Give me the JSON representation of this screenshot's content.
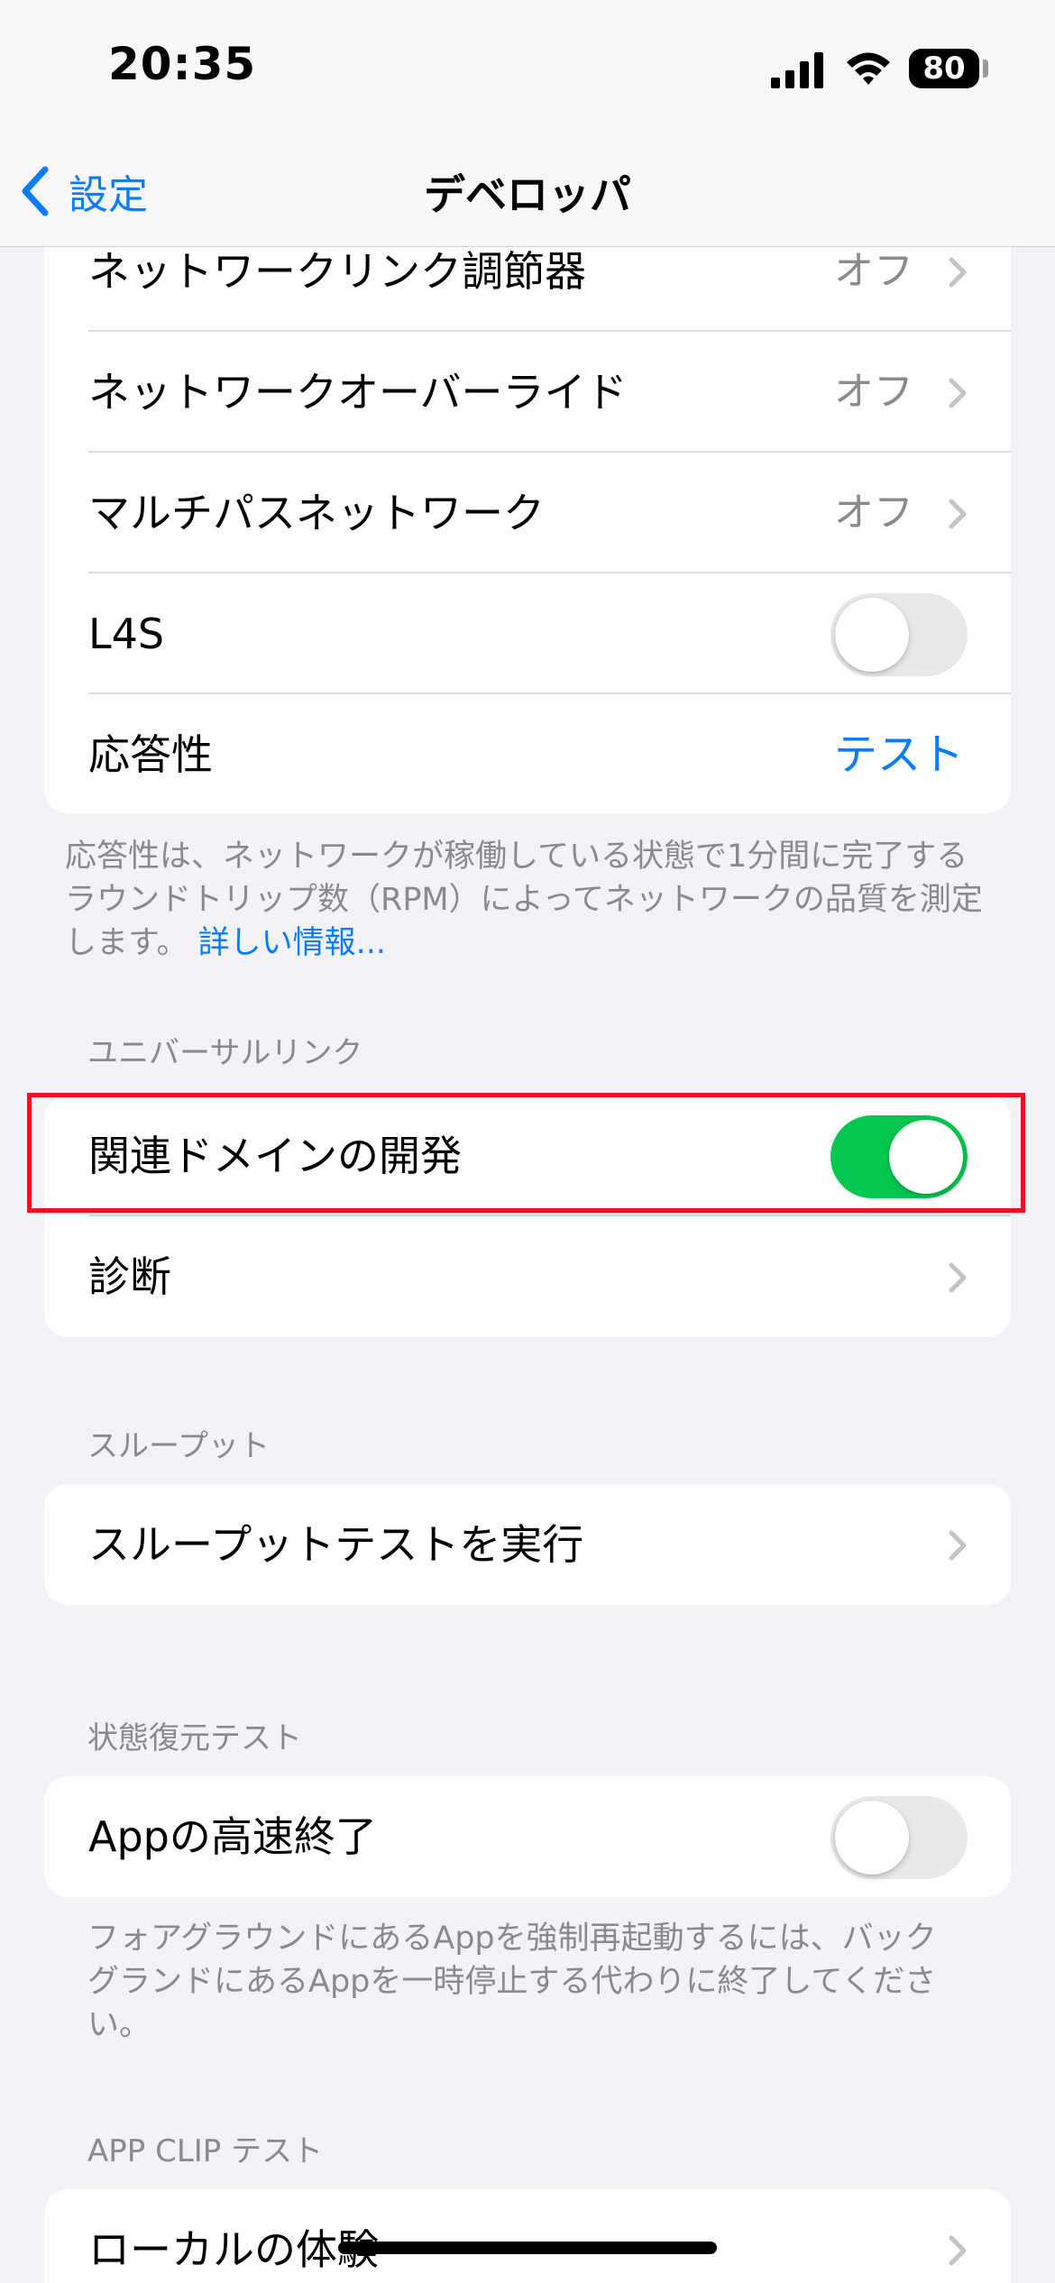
{
  "status_bar": {
    "time": "20:35",
    "battery": "80"
  },
  "nav": {
    "back_label": "設定",
    "title": "デベロッパ"
  },
  "network_group": {
    "rows": [
      {
        "label": "ネットワークリンク調節器",
        "value": "オフ"
      },
      {
        "label": "ネットワークオーバーライド",
        "value": "オフ"
      },
      {
        "label": "マルチパスネットワーク",
        "value": "オフ"
      },
      {
        "label": "L4S",
        "toggle": false
      },
      {
        "label": "応答性",
        "action": "テスト"
      }
    ],
    "footnote": "応答性は、ネットワークが稼働している状態で1分間に完了するラウンドトリップ数（RPM）によってネットワークの品質を測定します。",
    "footnote_link": "詳しい情報..."
  },
  "universal_links": {
    "header": "ユニバーサルリンク",
    "rows": [
      {
        "label": "関連ドメインの開発",
        "toggle": true
      },
      {
        "label": "診断"
      }
    ]
  },
  "throughput": {
    "header": "スループット",
    "rows": [
      {
        "label": "スループットテストを実行"
      }
    ]
  },
  "state_restoration": {
    "header": "状態復元テスト",
    "rows": [
      {
        "label": "Appの高速終了",
        "toggle": false
      }
    ],
    "footnote": "フォアグラウンドにあるAppを強制再起動するには、バックグランドにあるAppを一時停止する代わりに終了してください。"
  },
  "app_clip": {
    "header": "APP CLIP テスト",
    "rows": [
      {
        "label": "ローカルの体験"
      }
    ]
  },
  "colors": {
    "accent": "#0a7cff",
    "toggle_on": "#04c74f",
    "highlight_border": "#e8141e"
  }
}
